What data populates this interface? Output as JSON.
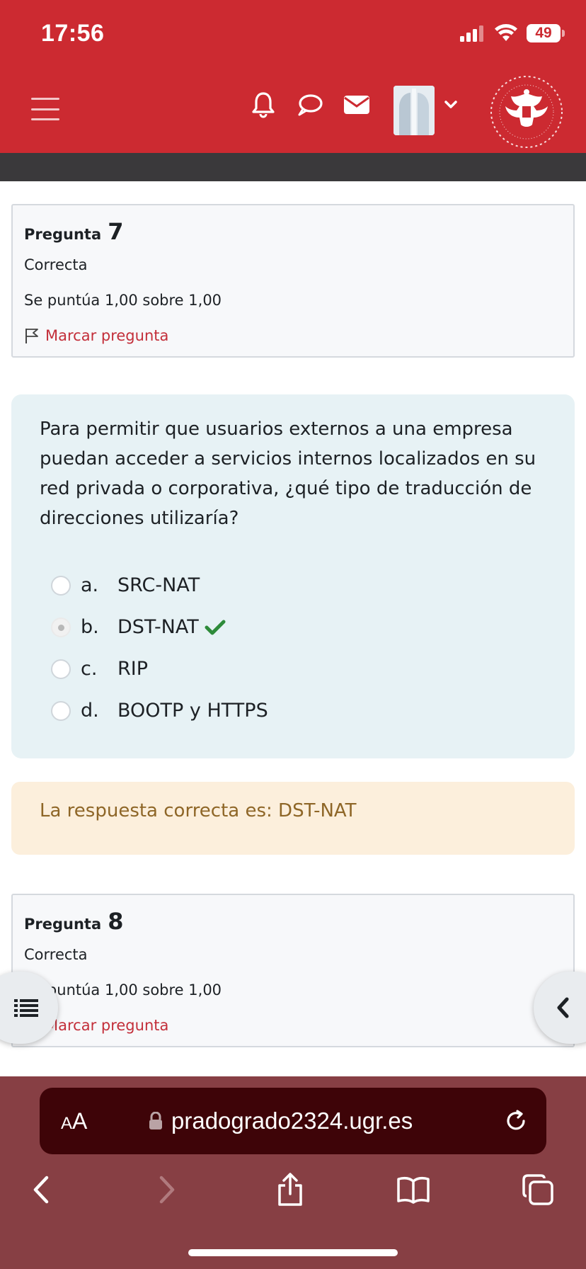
{
  "status_bar": {
    "time": "17:56",
    "battery": "49"
  },
  "question7": {
    "label": "Pregunta",
    "number": "7",
    "state": "Correcta",
    "grade": "Se puntúa 1,00 sobre 1,00",
    "flag_label": "Marcar pregunta"
  },
  "formulation": {
    "text": "Para permitir que usuarios externos a una empresa puedan acceder a servicios internos localizados en su red privada o corporativa, ¿qué tipo de traducción de direcciones utilizaría?",
    "answers": [
      {
        "letter": "a.",
        "text": "SRC-NAT"
      },
      {
        "letter": "b.",
        "text": "DST-NAT"
      },
      {
        "letter": "c.",
        "text": "RIP"
      },
      {
        "letter": "d.",
        "text": "BOOTP y HTTPS"
      }
    ]
  },
  "feedback": {
    "text": "La respuesta correcta es: DST-NAT"
  },
  "question8": {
    "label": "Pregunta",
    "number": "8",
    "state": "Correcta",
    "grade": "Se puntúa 1,00 sobre 1,00",
    "flag_label": "Marcar pregunta"
  },
  "browser": {
    "aa_big": "A",
    "aa_small": "A",
    "url": "pradogrado2324.ugr.es"
  },
  "colors": {
    "brand": "#cc2a31",
    "accent_link": "#c32f3a",
    "correct": "#2e8b3a",
    "feedback_text": "#8e6627"
  }
}
